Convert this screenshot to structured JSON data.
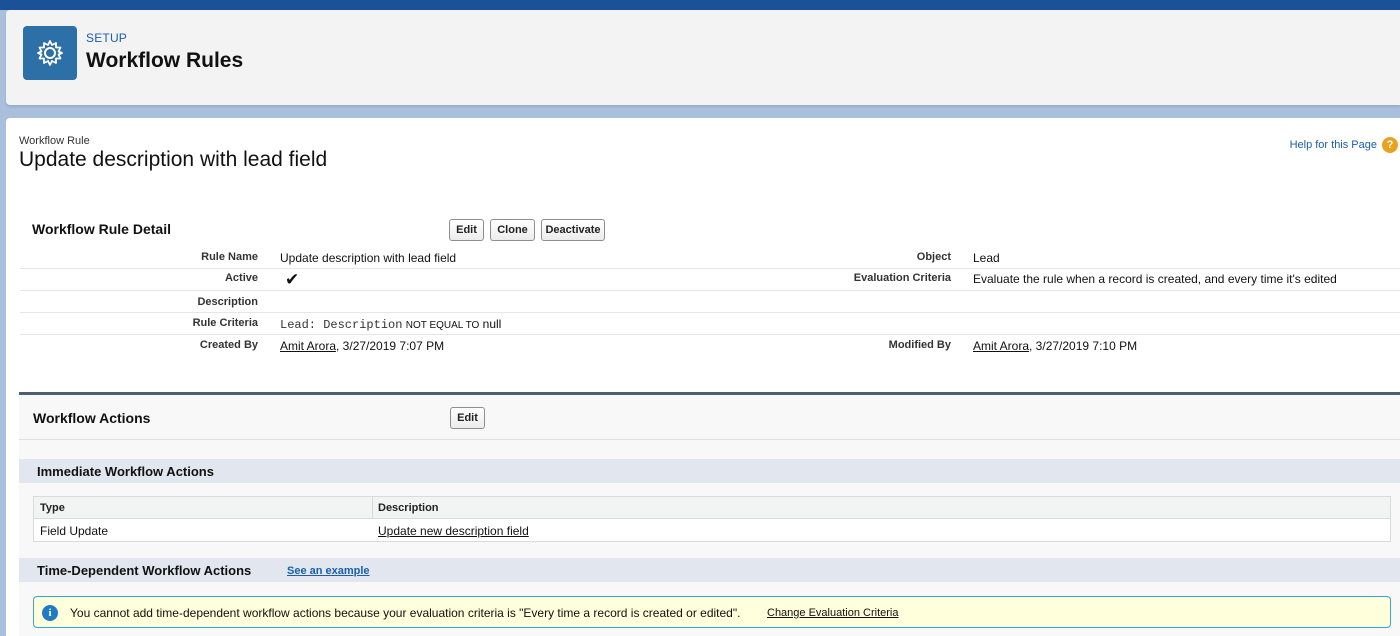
{
  "header": {
    "breadcrumb": "SETUP",
    "title": "Workflow Rules",
    "icon": "gear-icon"
  },
  "record": {
    "type_label": "Workflow Rule",
    "title": "Update description with lead field",
    "help_link": "Help for this Page",
    "help_icon": "?"
  },
  "detail": {
    "section_title": "Workflow Rule Detail",
    "buttons": {
      "edit": "Edit",
      "clone": "Clone",
      "deactivate": "Deactivate"
    },
    "fields": {
      "rule_name_label": "Rule Name",
      "rule_name_value": "Update description with lead field",
      "object_label": "Object",
      "object_value": "Lead",
      "active_label": "Active",
      "active_value": "✔",
      "evaluation_label": "Evaluation Criteria",
      "evaluation_value": "Evaluate the rule when a record is created, and every time it's edited",
      "description_label": "Description",
      "rule_criteria_label": "Rule Criteria",
      "rule_criteria_field": "Lead: Description",
      "rule_criteria_operator": "NOT EQUAL TO",
      "rule_criteria_value": "null",
      "created_by_label": "Created By",
      "created_by_user": "Amit Arora",
      "created_by_date": ", 3/27/2019 7:07 PM",
      "modified_by_label": "Modified By",
      "modified_by_user": "Amit Arora",
      "modified_by_date": ", 3/27/2019 7:10 PM"
    }
  },
  "actions": {
    "section_title": "Workflow Actions",
    "edit_button": "Edit",
    "immediate": {
      "title": "Immediate Workflow Actions",
      "columns": [
        "Type",
        "Description"
      ],
      "rows": [
        {
          "type": "Field Update",
          "description": "Update new description field"
        }
      ]
    },
    "time_dependent": {
      "title": "Time-Dependent Workflow Actions",
      "example_link": "See an example",
      "info_text": "You cannot add time-dependent workflow actions because your evaluation criteria is \"Every time a record is created or edited\".",
      "info_link": "Change Evaluation Criteria"
    }
  }
}
